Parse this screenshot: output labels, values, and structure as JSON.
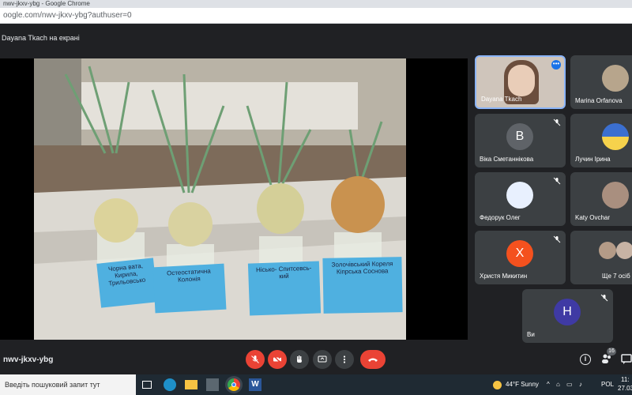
{
  "browser": {
    "window_title": "nwv-jkxv-ybg - Google Chrome",
    "url": "oogle.com/nwv-jkxv-ybg?authuser=0"
  },
  "meet": {
    "presenting_label": "Dayana Tkach на екрані",
    "meeting_code": "nwv-jkxv-ybg",
    "participant_count": "16",
    "participants": [
      {
        "name": "Dayana Tkach",
        "initial": "",
        "color": "#d6cbbf"
      },
      {
        "name": "Marina Orfanova",
        "initial": "",
        "color": "#b7a58c"
      },
      {
        "name": "Віка Сметаннікова",
        "initial": "B",
        "color": "#5f6368"
      },
      {
        "name": "Лучин Ірина",
        "initial": "",
        "color": "#f6d24c"
      },
      {
        "name": "Федорук Олег",
        "initial": "",
        "color": "#e8f0fe"
      },
      {
        "name": "Katy Ovchar",
        "initial": "",
        "color": "#a98f7f"
      },
      {
        "name": "Христя Микитин",
        "initial": "X",
        "color": "#f4511e"
      },
      {
        "name": "Ще 7 осіб",
        "initial": "",
        "color": "#8d8d8d"
      },
      {
        "name": "Ви",
        "initial": "H",
        "color": "#3f3aa4"
      }
    ],
    "photo_labels": [
      "Чорна вата, Кирила, Трильовсько",
      "Остеостатична Колонія",
      "Нісько- Спитсевсь- кий",
      "Золочівський Кореля Кіпрська Соснова"
    ]
  },
  "taskbar": {
    "search_placeholder": "Введіть пошуковий запит тут",
    "weather": "44°F Sunny",
    "lang": "POL",
    "time": "11:",
    "date": "27.03."
  }
}
